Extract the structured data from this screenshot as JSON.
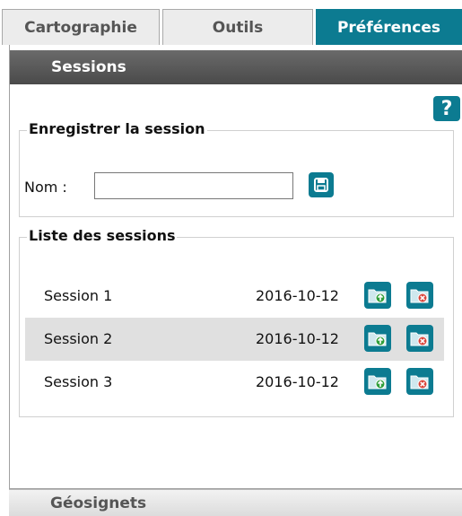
{
  "tabs": [
    {
      "label": "Cartographie"
    },
    {
      "label": "Outils"
    },
    {
      "label": "Préférences"
    }
  ],
  "panel": {
    "title": "Sessions",
    "help_icon": "?"
  },
  "save_group": {
    "legend": "Enregistrer la session",
    "name_label": "Nom :",
    "name_value": "",
    "save_icon": "save-icon"
  },
  "list_group": {
    "legend": "Liste des sessions",
    "sessions": [
      {
        "name": "Session 1",
        "date": "2016-10-12"
      },
      {
        "name": "Session 2",
        "date": "2016-10-12"
      },
      {
        "name": "Session 3",
        "date": "2016-10-12"
      }
    ]
  },
  "bottom_section": {
    "title": "Géosignets"
  },
  "colors": {
    "accent": "#0c7b91",
    "header": "#555555"
  }
}
